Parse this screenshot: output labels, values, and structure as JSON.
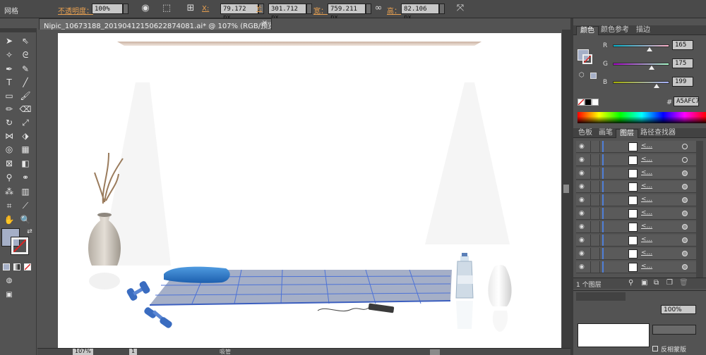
{
  "control_bar": {
    "workspace_label": "网格",
    "opacity_label": "不透明度：",
    "opacity_value": "100%",
    "x_label": "X:",
    "x_value": "79.172 px",
    "y_label": "Y:",
    "y_value": "301.712 px",
    "width_label": "宽：",
    "width_value": "759.211 px",
    "height_label": "高：",
    "height_value": "82.106 px"
  },
  "document": {
    "tab_title": "Nipic_10673188_20190412150622874081.ai* @ 107% (RGB/预览)",
    "close_glyph": "×"
  },
  "color_panel": {
    "tabs": [
      "颜色",
      "颜色参考",
      "描边"
    ],
    "active_tab": "颜色",
    "channels": [
      {
        "label": "R",
        "value": "165",
        "level": 165
      },
      {
        "label": "G",
        "value": "175",
        "level": 175
      },
      {
        "label": "B",
        "value": "199",
        "level": 199
      }
    ],
    "hex_symbol": "#",
    "hex_value": "A5AFC7",
    "fill_color": "#a5afc7"
  },
  "layers_panel": {
    "tabs": [
      "色板",
      "画笔",
      "图层",
      "路径查找器"
    ],
    "active_tab": "图层",
    "rows": [
      {
        "name": "<...",
        "target": "hollow"
      },
      {
        "name": "<...",
        "target": "hollow"
      },
      {
        "name": "<...",
        "target": "filled"
      },
      {
        "name": "<...",
        "target": "filled"
      },
      {
        "name": "<...",
        "target": "filled"
      },
      {
        "name": "<...",
        "target": "filled"
      },
      {
        "name": "<...",
        "target": "filled"
      },
      {
        "name": "<...",
        "target": "filled"
      },
      {
        "name": "<...",
        "target": "filled"
      },
      {
        "name": "<...",
        "target": "filled"
      }
    ],
    "footer_count": "1 个图层"
  },
  "bottom_panel": {
    "opacity_value": "100%",
    "invert_label": "反相蒙版"
  },
  "status_bar": {
    "zoom": "107%",
    "page": "1",
    "tool": "吸管"
  },
  "colors": {
    "ui_bg": "#535353",
    "accent_orange": "#e8a050",
    "mat": "#a5afc7",
    "dumbbell": "#3a6cc0"
  }
}
